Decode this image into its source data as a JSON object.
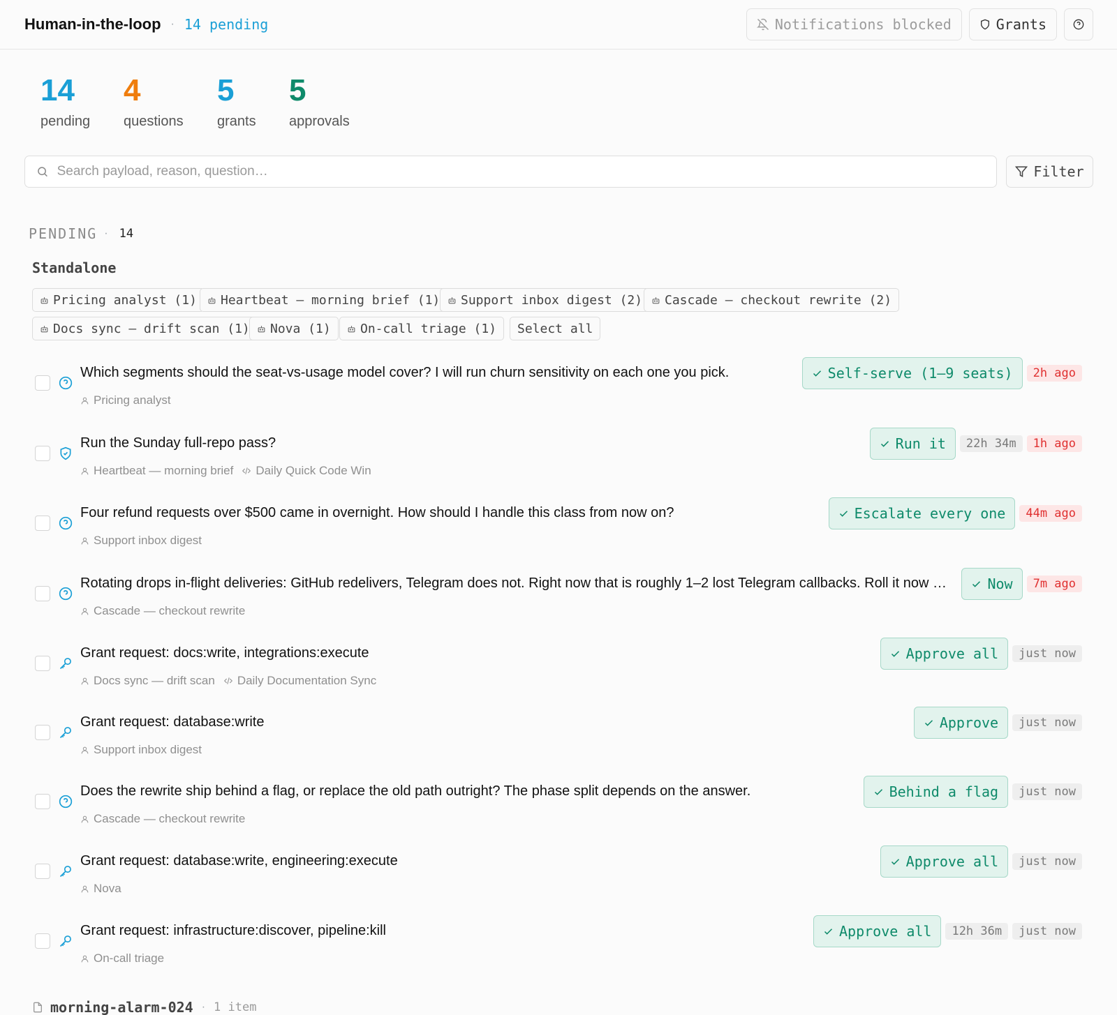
{
  "header": {
    "title": "Human-in-the-loop",
    "pending_label": "14 pending",
    "notifications_label": "Notifications blocked",
    "grants_label": "Grants"
  },
  "stats": [
    {
      "value": "14",
      "label": "pending",
      "color": "#1a9fd6"
    },
    {
      "value": "4",
      "label": "questions",
      "color": "#ef7d0d"
    },
    {
      "value": "5",
      "label": "grants",
      "color": "#1a9fd6"
    },
    {
      "value": "5",
      "label": "approvals",
      "color": "#0e8a6a"
    }
  ],
  "search": {
    "placeholder": "Search payload, reason, question…",
    "value": ""
  },
  "filter_label": "Filter",
  "section": {
    "title": "PENDING",
    "count": "14"
  },
  "group": {
    "title": "Standalone"
  },
  "chips": [
    "Pricing analyst (1)",
    "Heartbeat — morning brief (1)",
    "Support inbox digest (2)",
    "Cascade — checkout rewrite (2)",
    "Docs sync — drift scan (1)",
    "Nova (1)",
    "On-call triage (1)",
    "Select all"
  ],
  "items": [
    {
      "type": "question",
      "text": "Which segments should the seat-vs-usage model cover? I will run churn sensitivity on each one you pick.",
      "agent": "Pricing analyst",
      "workflow": "",
      "action": "Self-serve (1–9 seats)",
      "badges": [
        {
          "text": "2h ago",
          "tone": "red"
        }
      ]
    },
    {
      "type": "approval",
      "text": "Run the Sunday full-repo pass?",
      "agent": "Heartbeat — morning brief",
      "workflow": "Daily Quick Code Win",
      "action": "Run it",
      "badges": [
        {
          "text": "22h 34m",
          "tone": "gray"
        },
        {
          "text": "1h ago",
          "tone": "red"
        }
      ]
    },
    {
      "type": "question",
      "text": "Four refund requests over $500 came in overnight. How should I handle this class from now on?",
      "agent": "Support inbox digest",
      "workflow": "",
      "action": "Escalate every one",
      "badges": [
        {
          "text": "44m ago",
          "tone": "red"
        }
      ]
    },
    {
      "type": "question",
      "text": "Rotating drops in-flight deliveries: GitHub redelivers, Telegram does not. Right now that is roughly 1–2 lost Telegram callbacks. Roll it now or wait for a quiet window?",
      "agent": "Cascade — checkout rewrite",
      "workflow": "",
      "action": "Now",
      "badges": [
        {
          "text": "7m ago",
          "tone": "red"
        }
      ]
    },
    {
      "type": "grant",
      "text": "Grant request: docs:write, integrations:execute",
      "agent": "Docs sync — drift scan",
      "workflow": "Daily Documentation Sync",
      "action": "Approve all",
      "badges": [
        {
          "text": "just now",
          "tone": "gray"
        }
      ]
    },
    {
      "type": "grant",
      "text": "Grant request: database:write",
      "agent": "Support inbox digest",
      "workflow": "",
      "action": "Approve",
      "badges": [
        {
          "text": "just now",
          "tone": "gray"
        }
      ]
    },
    {
      "type": "question",
      "text": "Does the rewrite ship behind a flag, or replace the old path outright? The phase split depends on the answer.",
      "agent": "Cascade — checkout rewrite",
      "workflow": "",
      "action": "Behind a flag",
      "badges": [
        {
          "text": "just now",
          "tone": "gray"
        }
      ]
    },
    {
      "type": "grant",
      "text": "Grant request: database:write, engineering:execute",
      "agent": "Nova",
      "workflow": "",
      "action": "Approve all",
      "badges": [
        {
          "text": "just now",
          "tone": "gray"
        }
      ]
    },
    {
      "type": "grant",
      "text": "Grant request: infrastructure:discover, pipeline:kill",
      "agent": "On-call triage",
      "workflow": "",
      "action": "Approve all",
      "badges": [
        {
          "text": "12h 36m",
          "tone": "gray"
        },
        {
          "text": "just now",
          "tone": "gray"
        }
      ]
    }
  ],
  "footer_group": {
    "title": "morning-alarm-024",
    "count": "1 item"
  },
  "colors": {
    "accent": "#1a9fd6",
    "approve": "#0e8a6a",
    "danger": "#e03131"
  }
}
